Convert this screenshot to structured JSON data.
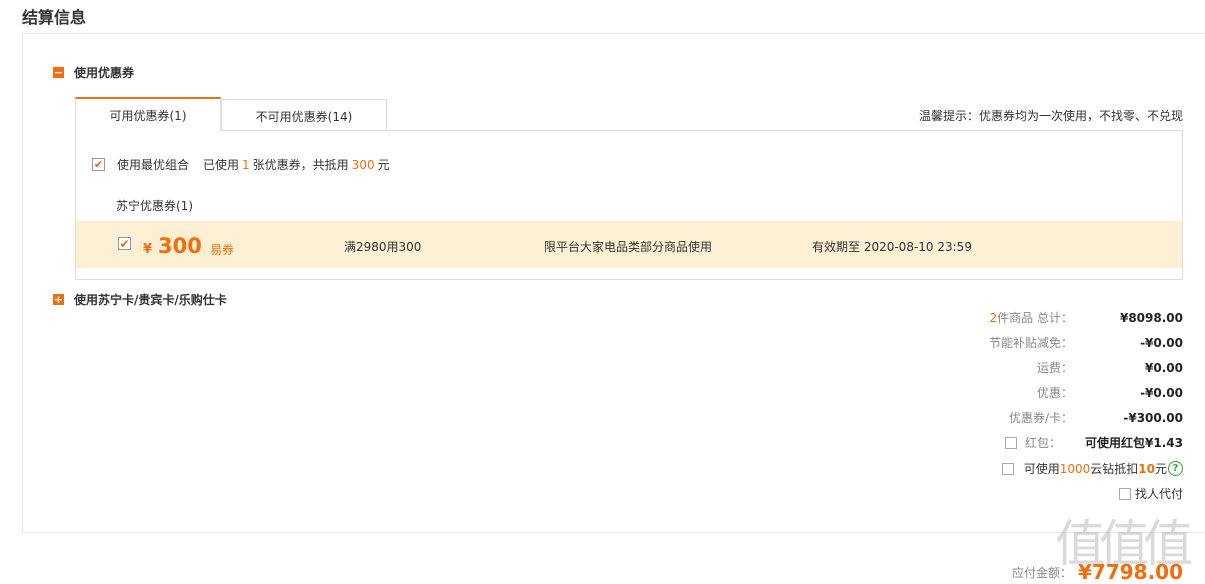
{
  "title": "结算信息",
  "coupon_section": {
    "label": "使用优惠券",
    "toggle": "−",
    "tabs": [
      {
        "label": "可用优惠券(1)"
      },
      {
        "label": "不可用优惠券(14)"
      }
    ],
    "tip": "温馨提示：优惠券均为一次使用，不找零、不兑现",
    "best": {
      "label": "使用最优组合",
      "summary_pre": "已使用",
      "count": "1",
      "summary_mid": "张优惠券，共抵用",
      "amount": "300",
      "unit": "元"
    },
    "group_label": "苏宁优惠券(1)",
    "coupon": {
      "currency": "¥",
      "amount": "300",
      "type": "易券",
      "condition": "满2980用300",
      "scope": "限平台大家电品类部分商品使用",
      "expiry": "有效期至 2020-08-10 23:59"
    }
  },
  "card_section": {
    "label": "使用苏宁卡/贵宾卡/乐购仕卡",
    "toggle": "+"
  },
  "summary": {
    "items_count": "2",
    "items_label": "件商品 总计：",
    "items_total": "¥8098.00",
    "subsidy_label": "节能补贴减免：",
    "subsidy_value": "-¥0.00",
    "shipping_label": "运费：",
    "shipping_value": "¥0.00",
    "discount_label": "优惠：",
    "discount_value": "-¥0.00",
    "coupon_label": "优惠券/卡：",
    "coupon_value": "-¥300.00",
    "redpacket_label": "红包：",
    "redpacket_value": "可使用红包¥1.43",
    "diamond_pre": "可使用",
    "diamond_count": "1000",
    "diamond_mid": "云钻抵扣",
    "diamond_amount": "10",
    "diamond_unit": "元",
    "proxy_label": "找人代付",
    "payable_label": "应付金额：",
    "payable_value": "¥7798.00"
  },
  "watermark": "值值值"
}
